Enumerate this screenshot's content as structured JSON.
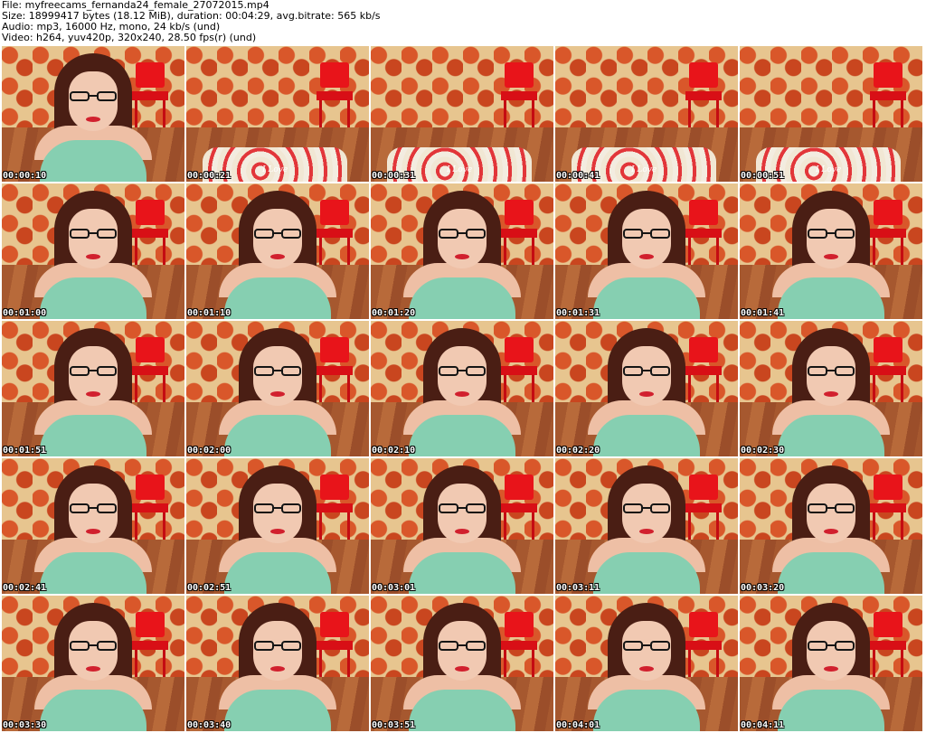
{
  "header": {
    "file_line": "File: myfreecams_fernanda24_female_27072015.mp4",
    "size_line": "Size: 18999417 bytes (18.12 MiB), duration: 00:04:29, avg.bitrate: 565 kb/s",
    "audio_line": "Audio: mp3, 16000 Hz, mono, 24 kb/s (und)",
    "video_line": "Video: h264, yuv420p, 320x240, 28.50 fps(r) (und)"
  },
  "colors": {
    "wall": "#e7c58f",
    "pattern": "#d9572a",
    "chair": "#e8141a",
    "floor": "#a6582f",
    "hair": "#4a1e14",
    "skin": "#f1c9b2",
    "shirt": "#86cfb1",
    "lips": "#d1202e"
  },
  "thumbnails": [
    {
      "time": "00:00:10",
      "scene": "person"
    },
    {
      "time": "00:00:21",
      "scene": "room",
      "bed_text": "I Love"
    },
    {
      "time": "00:00:31",
      "scene": "room",
      "bed_text": "I Love"
    },
    {
      "time": "00:00:41",
      "scene": "room",
      "bed_text": "I Love"
    },
    {
      "time": "00:00:51",
      "scene": "room",
      "bed_text": "I Love"
    },
    {
      "time": "00:01:00",
      "scene": "person"
    },
    {
      "time": "00:01:10",
      "scene": "person"
    },
    {
      "time": "00:01:20",
      "scene": "person"
    },
    {
      "time": "00:01:31",
      "scene": "person"
    },
    {
      "time": "00:01:41",
      "scene": "person"
    },
    {
      "time": "00:01:51",
      "scene": "person"
    },
    {
      "time": "00:02:00",
      "scene": "person"
    },
    {
      "time": "00:02:10",
      "scene": "person"
    },
    {
      "time": "00:02:20",
      "scene": "person"
    },
    {
      "time": "00:02:30",
      "scene": "person"
    },
    {
      "time": "00:02:41",
      "scene": "person"
    },
    {
      "time": "00:02:51",
      "scene": "person"
    },
    {
      "time": "00:03:01",
      "scene": "person"
    },
    {
      "time": "00:03:11",
      "scene": "person"
    },
    {
      "time": "00:03:20",
      "scene": "person"
    },
    {
      "time": "00:03:30",
      "scene": "person"
    },
    {
      "time": "00:03:40",
      "scene": "person"
    },
    {
      "time": "00:03:51",
      "scene": "person"
    },
    {
      "time": "00:04:01",
      "scene": "person"
    },
    {
      "time": "00:04:11",
      "scene": "person"
    }
  ]
}
